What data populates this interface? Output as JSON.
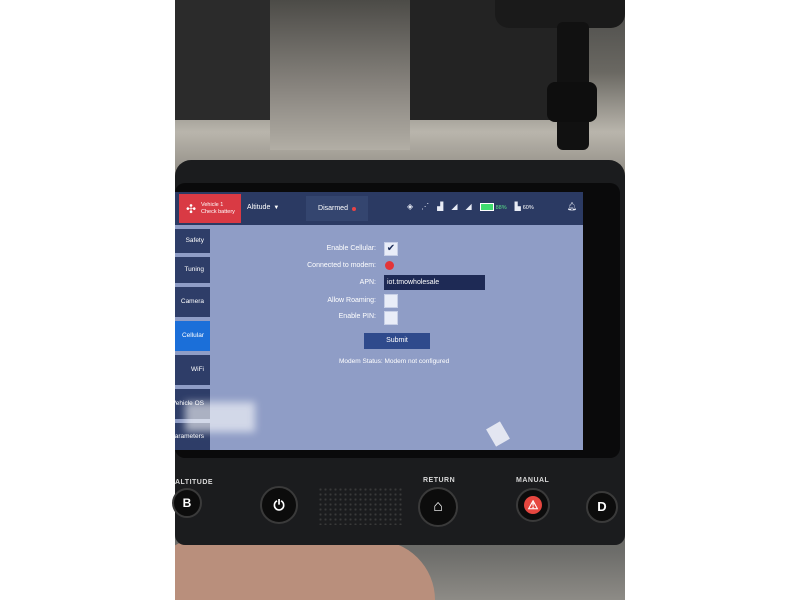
{
  "topbar": {
    "alert_line1": "Vehicle 1",
    "alert_line2": "Check battery",
    "altitude_mode": "Altitude",
    "arm_state": "Disarmed",
    "battery_pct_1": "88%",
    "battery_pct_2": "60%",
    "icons": [
      "drone-icon",
      "gps-icon",
      "satellite-icon",
      "signal-icon",
      "signal-icon",
      "signal-icon",
      "battery-icon",
      "controller-icon",
      "bell-icon"
    ]
  },
  "sidebar": {
    "items": [
      {
        "label": "Safety"
      },
      {
        "label": "Tuning"
      },
      {
        "label": "Camera"
      },
      {
        "label": "Cellular"
      },
      {
        "label": "WiFi"
      },
      {
        "label": "Vehicle OS"
      },
      {
        "label": "Parameters"
      }
    ]
  },
  "form": {
    "enable_cellular_label": "Enable Cellular:",
    "enable_cellular_checked": true,
    "connected_label": "Connected to modem:",
    "apn_label": "APN:",
    "apn_value": "iot.tmowholesale",
    "allow_roaming_label": "Allow Roaming:",
    "allow_roaming_checked": false,
    "enable_pin_label": "Enable PIN:",
    "enable_pin_checked": false,
    "submit_label": "Submit",
    "modem_status": "Modem Status: Modem not configured"
  },
  "controls": {
    "altitude_label": "ALTITUDE",
    "b_button": "B",
    "return_label": "RETURN",
    "manual_label": "MANUAL",
    "d_button": "D"
  },
  "colors": {
    "topbar": "#2b3a63",
    "alert": "#d93a44",
    "screen_bg": "#8f9dc6",
    "active_tab": "#1b6fd9",
    "connected_status": "#e33438"
  }
}
